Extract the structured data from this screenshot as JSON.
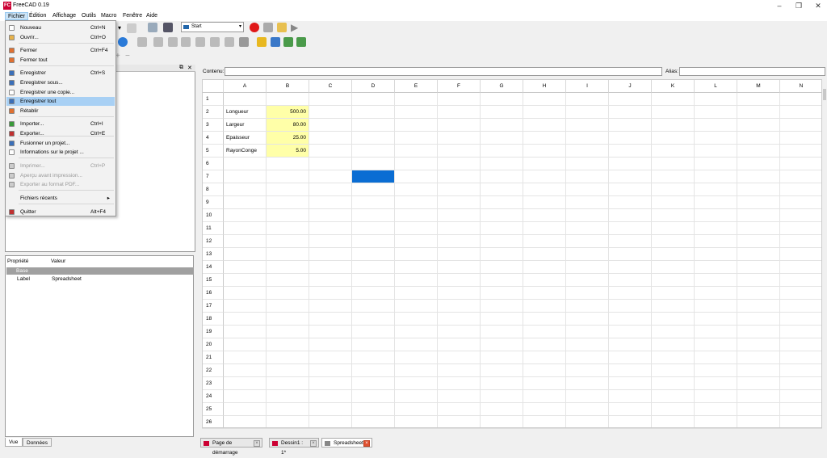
{
  "window": {
    "title": "FreeCAD 0.19",
    "logo": "FC"
  },
  "menubar": [
    "Fichier",
    "Édition",
    "Affichage",
    "Outils",
    "Macro",
    "Fenêtre",
    "Aide"
  ],
  "toolbar": {
    "workbench": "Start"
  },
  "file_menu": {
    "items": [
      {
        "label": "Nouveau",
        "shortcut": "Ctrl+N",
        "icon": "new-document-icon",
        "color": "#ffffff"
      },
      {
        "label": "Ouvrir...",
        "shortcut": "Ctrl+O",
        "icon": "open-folder-icon",
        "color": "#e7b24a"
      },
      {
        "label": "Fermer",
        "shortcut": "Ctrl+F4",
        "icon": "close-document-icon",
        "color": "#e07030"
      },
      {
        "label": "Fermer tout",
        "shortcut": "",
        "icon": "close-all-icon",
        "color": "#e07030"
      },
      {
        "label": "Enregistrer",
        "shortcut": "Ctrl+S",
        "icon": "save-icon",
        "color": "#3a6fb8"
      },
      {
        "label": "Enregistrer sous...",
        "shortcut": "",
        "icon": "save-as-icon",
        "color": "#3a6fb8"
      },
      {
        "label": "Enregistrer une copie...",
        "shortcut": "",
        "icon": "save-copy-icon",
        "color": "#ffffff"
      },
      {
        "label": "Enregistrer tout",
        "shortcut": "",
        "icon": "save-all-icon",
        "color": "#3a6fb8"
      },
      {
        "label": "Rétablir",
        "shortcut": "",
        "icon": "revert-icon",
        "color": "#e07030"
      },
      {
        "label": "Importer...",
        "shortcut": "Ctrl+I",
        "icon": "import-icon",
        "color": "#3a9a3a"
      },
      {
        "label": "Exporter...",
        "shortcut": "Ctrl+E",
        "icon": "export-icon",
        "color": "#c03030"
      },
      {
        "label": "Fusionner un projet...",
        "shortcut": "",
        "icon": "merge-project-icon",
        "color": "#3a6fb8"
      },
      {
        "label": "Informations sur le projet ...",
        "shortcut": "",
        "icon": "project-info-icon",
        "color": "#ffffff"
      },
      {
        "label": "Imprimer...",
        "shortcut": "Ctrl+P",
        "icon": "print-icon",
        "color": "#cccccc"
      },
      {
        "label": "Aperçu avant impression...",
        "shortcut": "",
        "icon": "print-preview-icon",
        "color": "#cccccc"
      },
      {
        "label": "Exporter au format PDF...",
        "shortcut": "",
        "icon": "pdf-icon",
        "color": "#cccccc"
      },
      {
        "label": "Fichiers récents",
        "shortcut": "",
        "icon": "",
        "color": "#ffffff"
      },
      {
        "label": "Quitter",
        "shortcut": "Alt+F4",
        "icon": "quit-icon",
        "color": "#c03030"
      }
    ],
    "submenu_arrow": "▸"
  },
  "properties": {
    "header_property": "Propriété",
    "header_value": "Valeur",
    "group": "Base",
    "row_name": "Label",
    "row_value": "Spreadsheet"
  },
  "left_tabs": [
    "Vue",
    "Données"
  ],
  "contenu": {
    "label": "Contenu:",
    "alias_label": "Alias:",
    "value": "",
    "alias": ""
  },
  "sheet": {
    "columns": [
      "A",
      "B",
      "C",
      "D",
      "E",
      "F",
      "G",
      "H",
      "I",
      "J",
      "K",
      "L",
      "M",
      "N"
    ],
    "rows": [
      "1",
      "2",
      "3",
      "4",
      "5",
      "6",
      "7",
      "8",
      "9",
      "10",
      "11",
      "12",
      "13",
      "14",
      "15",
      "16",
      "17",
      "18",
      "19",
      "20",
      "21",
      "22",
      "23",
      "24",
      "25",
      "26"
    ],
    "cells": [
      {
        "row": 2,
        "label": "Longueur",
        "value": "500.00"
      },
      {
        "row": 3,
        "label": "Largeur",
        "value": "80.00"
      },
      {
        "row": 4,
        "label": "Epaisseur",
        "value": "25.00"
      },
      {
        "row": 5,
        "label": "RayonConge",
        "value": "5.00"
      }
    ],
    "selected": {
      "row": 7,
      "col": "D"
    },
    "value_bg": "#ffffa8",
    "selection_color": "#0a6dd3"
  },
  "bottom_tabs": [
    {
      "label": "Page de démarrage",
      "icon": "freecad-start-icon"
    },
    {
      "label": "Dessin1 : 1*",
      "icon": "freecad-doc-icon"
    },
    {
      "label": "Spreadsheet*",
      "icon": "spreadsheet-icon"
    }
  ]
}
